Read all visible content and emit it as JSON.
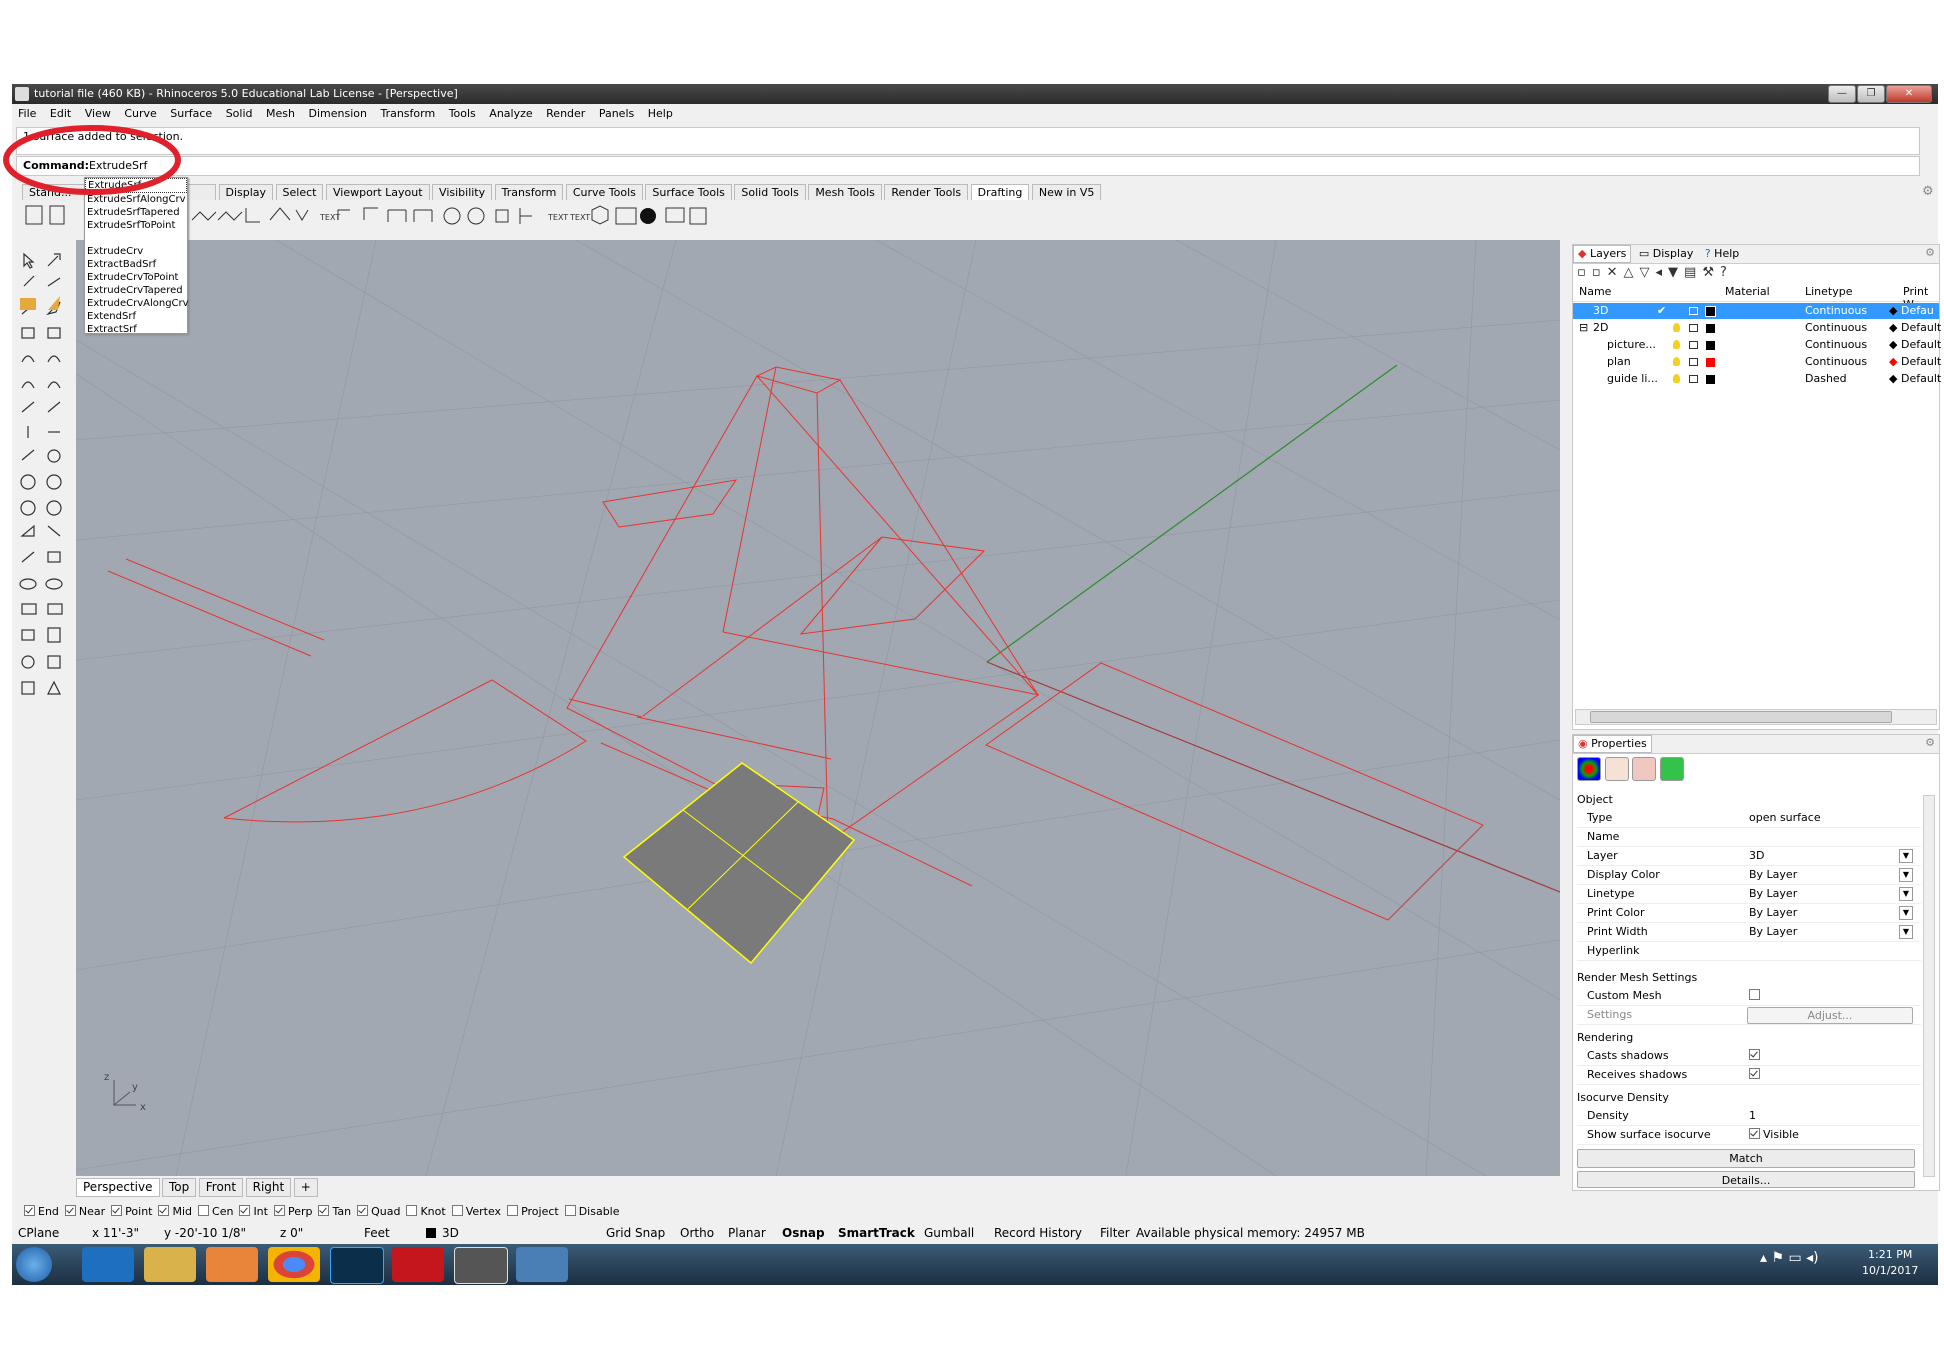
{
  "window": {
    "title": "tutorial file (460 KB) - Rhinoceros 5.0 Educational Lab License - [Perspective]"
  },
  "menu": [
    "File",
    "Edit",
    "View",
    "Curve",
    "Surface",
    "Solid",
    "Mesh",
    "Dimension",
    "Transform",
    "Tools",
    "Analyze",
    "Render",
    "Panels",
    "Help"
  ],
  "command": {
    "history": "1 surface added to selection.",
    "label": "Command:",
    "value": "ExtrudeSrf"
  },
  "autocomplete": {
    "items": [
      "ExtrudeSrf",
      "ExtrudeSrfAlongCrv",
      "ExtrudeSrfTapered",
      "ExtrudeSrfToPoint",
      "",
      "ExtrudeCrv",
      "ExtractBadSrf",
      "ExtrudeCrvToPoint",
      "ExtrudeCrvTapered",
      "ExtrudeCrvAlongCrv",
      "ExtendSrf",
      "ExtractSrf"
    ]
  },
  "toolbar_tabs": {
    "first": "Stand...",
    "items": [
      "Display",
      "Select",
      "Viewport Layout",
      "Visibility",
      "Transform",
      "Curve Tools",
      "Surface Tools",
      "Solid Tools",
      "Mesh Tools",
      "Render Tools",
      "Drafting",
      "New in V5"
    ],
    "active": "Drafting"
  },
  "viewport_tabs": {
    "items": [
      "Perspective",
      "Top",
      "Front",
      "Right"
    ],
    "add": "+",
    "active": "Perspective"
  },
  "axis_labels": {
    "x": "x",
    "y": "y",
    "z": "z"
  },
  "osnaps": [
    {
      "label": "End",
      "checked": true
    },
    {
      "label": "Near",
      "checked": true
    },
    {
      "label": "Point",
      "checked": true
    },
    {
      "label": "Mid",
      "checked": true
    },
    {
      "label": "Cen",
      "checked": false
    },
    {
      "label": "Int",
      "checked": true
    },
    {
      "label": "Perp",
      "checked": true
    },
    {
      "label": "Tan",
      "checked": true
    },
    {
      "label": "Quad",
      "checked": true
    },
    {
      "label": "Knot",
      "checked": false
    },
    {
      "label": "Vertex",
      "checked": false
    },
    {
      "label": "Project",
      "checked": false
    },
    {
      "label": "Disable",
      "checked": false
    }
  ],
  "status": {
    "cplane": "CPlane",
    "x": "x 11'-3\"",
    "y": "y -20'-10 1/8\"",
    "z": "z 0\"",
    "units": "Feet",
    "layer": "3D",
    "buttons": [
      "Grid Snap",
      "Ortho",
      "Planar",
      "Osnap",
      "SmartTrack",
      "Gumball",
      "Record History",
      "Filter"
    ],
    "memory": "Available physical memory: 24957 MB"
  },
  "layers_panel": {
    "tabs": [
      "Layers",
      "Display",
      "Help"
    ],
    "headers": [
      "Name",
      "Material",
      "Linetype",
      "Print W"
    ],
    "rows": [
      {
        "name": "3D",
        "linetype": "Continuous",
        "print": "Defau",
        "color": "#000000",
        "selected": true,
        "check": "✔",
        "indent": 0
      },
      {
        "name": "2D",
        "linetype": "Continuous",
        "print": "Default",
        "color": "#000000",
        "selected": false,
        "check": "",
        "indent": 0
      },
      {
        "name": "picture...",
        "linetype": "Continuous",
        "print": "Default",
        "color": "#000000",
        "selected": false,
        "check": "",
        "indent": 1
      },
      {
        "name": "plan",
        "linetype": "Continuous",
        "print": "Default",
        "color": "#ff0000",
        "selected": false,
        "check": "",
        "indent": 1
      },
      {
        "name": "guide li...",
        "linetype": "Dashed",
        "print": "Default",
        "color": "#000000",
        "selected": false,
        "check": "",
        "indent": 1
      }
    ]
  },
  "properties_panel": {
    "title": "Properties",
    "section_object": "Object",
    "rows": [
      {
        "key": "Type",
        "value": "open surface"
      },
      {
        "key": "Name",
        "value": ""
      },
      {
        "key": "Layer",
        "value": "3D"
      },
      {
        "key": "Display Color",
        "value": "By Layer"
      },
      {
        "key": "Linetype",
        "value": "By Layer"
      },
      {
        "key": "Print Color",
        "value": "By Layer"
      },
      {
        "key": "Print Width",
        "value": "By Layer"
      },
      {
        "key": "Hyperlink",
        "value": ""
      }
    ],
    "section_render_mesh": "Render Mesh Settings",
    "custom_mesh": "Custom Mesh",
    "settings": "Settings",
    "adjust": "Adjust...",
    "section_rendering": "Rendering",
    "casts_shadows": "Casts shadows",
    "receives_shadows": "Receives shadows",
    "section_isocurve": "Isocurve Density",
    "density_label": "Density",
    "density_value": "1",
    "show_isocurve": "Show surface isocurve",
    "visible": "Visible",
    "match": "Match",
    "details": "Details..."
  },
  "taskbar": {
    "time": "1:21 PM",
    "date": "10/1/2017"
  },
  "colors": {
    "viewport_bg": "#a1a8b2",
    "curves": "#e8332f",
    "selected": "#ffff00",
    "layer_selected": "#3399ff",
    "annotation_circle": "#e0202a"
  }
}
